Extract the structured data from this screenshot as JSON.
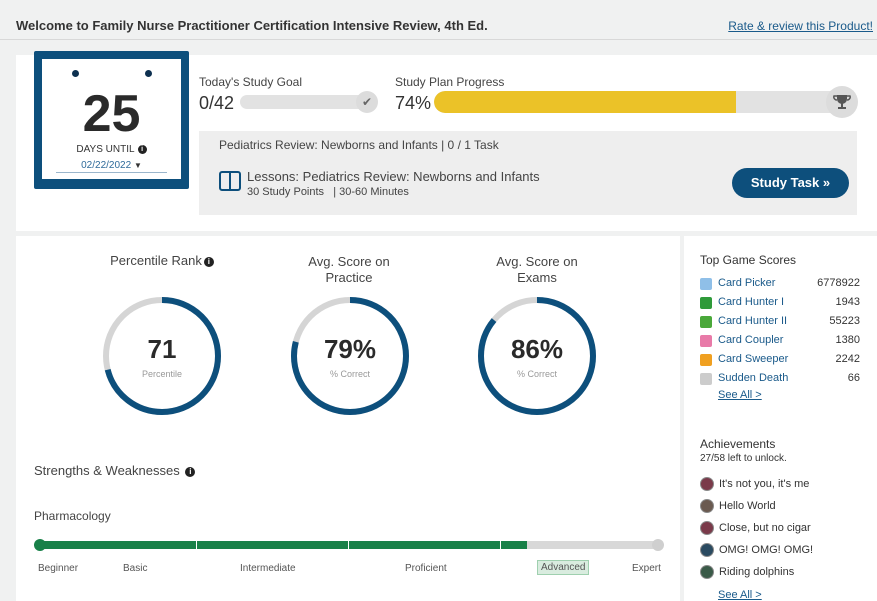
{
  "header": {
    "title": "Welcome to Family Nurse Practitioner Certification Intensive Review, 4th Ed.",
    "rate_link": "Rate & review this Product!"
  },
  "countdown": {
    "days": "25",
    "label": "DAYS UNTIL",
    "date": "02/22/2022"
  },
  "study_goal": {
    "label": "Today's Study Goal",
    "value": "0/42"
  },
  "study_plan": {
    "label": "Study Plan Progress",
    "value": "74%",
    "progress_percent": 74
  },
  "task": {
    "title": "Pediatrics Review: Newborns and Infants | 0 / 1 Task",
    "lesson": "Lessons: Pediatrics Review: Newborns and Infants",
    "points": "30 Study Points",
    "duration": "| 30-60 Minutes",
    "button": "Study Task »"
  },
  "stats": [
    {
      "title": "Percentile Rank",
      "value": "71",
      "sub": "Percentile",
      "fill_percent": 71
    },
    {
      "title": "Avg. Score on Practice",
      "value": "79%",
      "sub": "% Correct",
      "fill_percent": 79
    },
    {
      "title": "Avg. Score on Exams",
      "value": "86%",
      "sub": "% Correct",
      "fill_percent": 86
    }
  ],
  "strengths": {
    "title": "Strengths & Weaknesses",
    "subject": "Pharmacology",
    "progress_percent": 79,
    "levels": [
      "Beginner",
      "Basic",
      "Intermediate",
      "Proficient",
      "Advanced",
      "Expert"
    ],
    "current_level": "Advanced"
  },
  "games": {
    "title": "Top Game Scores",
    "items": [
      {
        "name": "Card Picker",
        "score": "6778922",
        "icon": "card-picker-icon",
        "color": "#8fbfe8"
      },
      {
        "name": "Card Hunter I",
        "score": "1943",
        "icon": "card-hunter-icon",
        "color": "#2f9a3a"
      },
      {
        "name": "Card Hunter II",
        "score": "55223",
        "icon": "card-hunter-ii-icon",
        "color": "#4aa83a"
      },
      {
        "name": "Card Coupler",
        "score": "1380",
        "icon": "heart-icon",
        "color": "#e87aa8"
      },
      {
        "name": "Card Sweeper",
        "score": "2242",
        "icon": "sweeper-icon",
        "color": "#f0a020"
      },
      {
        "name": "Sudden Death",
        "score": "66",
        "icon": "sudden-death-icon",
        "color": "#cccccc"
      }
    ],
    "see_all": "See All >"
  },
  "achievements": {
    "title": "Achievements",
    "subtitle": "27/58 left to unlock.",
    "items": [
      {
        "label": "It's not you, it's me",
        "color": "#7a3a4a"
      },
      {
        "label": "Hello World",
        "color": "#6a5a50"
      },
      {
        "label": "Close, but no cigar",
        "color": "#7a3a4a"
      },
      {
        "label": "OMG! OMG! OMG!",
        "color": "#2a4a60"
      },
      {
        "label": "Riding dolphins",
        "color": "#3a5a48"
      }
    ],
    "see_all": "See All >"
  }
}
